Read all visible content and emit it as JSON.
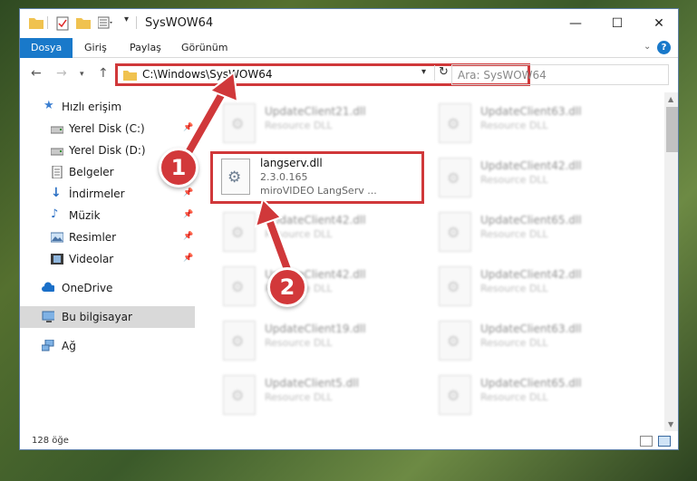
{
  "window": {
    "title": "SysWOW64"
  },
  "ribbon": {
    "tabs": [
      "Dosya",
      "Giriş",
      "Paylaş",
      "Görünüm"
    ],
    "help": "?"
  },
  "address": {
    "path": "C:\\Windows\\SysWOW64",
    "search_placeholder": "Ara: SysWOW64"
  },
  "sidebar": {
    "quick_access": "Hızlı erişim",
    "items": [
      "Yerel Disk (C:)",
      "Yerel Disk (D:)",
      "Belgeler",
      "İndirmeler",
      "Müzik",
      "Resimler",
      "Videolar"
    ],
    "onedrive": "OneDrive",
    "this_pc": "Bu bilgisayar",
    "network": "Ağ"
  },
  "files": {
    "left": [
      {
        "name": "UpdateClient21.dll",
        "type": "Resource DLL"
      },
      {
        "name": "UpdateClient42.dll",
        "type": "Resource DLL"
      },
      {
        "name": "UpdateClient42.dll",
        "type": "Resource DLL"
      },
      {
        "name": "UpdateClient19.dll",
        "type": "Resource DLL"
      },
      {
        "name": "UpdateClient5.dll",
        "type": "Resource DLL"
      }
    ],
    "right": [
      {
        "name": "UpdateClient63.dll",
        "type": "Resource DLL"
      },
      {
        "name": "UpdateClient42.dll",
        "type": "Resource DLL"
      },
      {
        "name": "UpdateClient65.dll",
        "type": "Resource DLL"
      },
      {
        "name": "UpdateClient42.dll",
        "type": "Resource DLL"
      },
      {
        "name": "UpdateClient63.dll",
        "type": "Resource DLL"
      },
      {
        "name": "UpdateClient65.dll",
        "type": "Resource DLL"
      }
    ],
    "focus": {
      "name": "langserv.dll",
      "version": "2.3.0.165",
      "description": "miroVIDEO LangServ ..."
    }
  },
  "status": {
    "count": "128 öğe"
  },
  "annotations": {
    "step1": "1",
    "step2": "2",
    "color": "#d0383a"
  }
}
